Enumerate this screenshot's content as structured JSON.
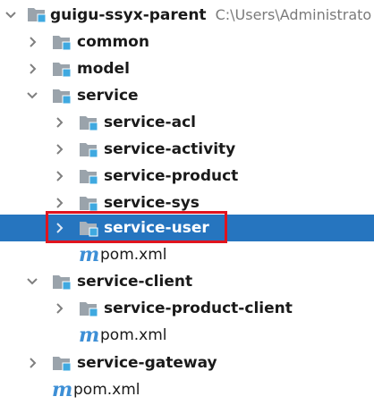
{
  "colors": {
    "selection": "#2675bf",
    "annotation": "#e0141e",
    "maven_icon": "#3d8fd6",
    "folder": "#9aa3ab",
    "folder_badge": "#3fa9e0"
  },
  "tree": {
    "root": {
      "label": "guigu-ssyx-parent",
      "path": "C:\\Users\\Administrato"
    },
    "common": {
      "label": "common"
    },
    "model": {
      "label": "model"
    },
    "service": {
      "label": "service"
    },
    "service_acl": {
      "label": "service-acl"
    },
    "service_activity": {
      "label": "service-activity"
    },
    "service_product": {
      "label": "service-product"
    },
    "service_sys": {
      "label": "service-sys"
    },
    "service_user": {
      "label": "service-user"
    },
    "service_pom": {
      "label": "pom.xml",
      "icon": "m"
    },
    "service_client": {
      "label": "service-client"
    },
    "service_product_client": {
      "label": "service-product-client"
    },
    "client_pom": {
      "label": "pom.xml",
      "icon": "m"
    },
    "service_gateway": {
      "label": "service-gateway"
    },
    "root_pom": {
      "label": "pom.xml",
      "icon": "m"
    }
  }
}
